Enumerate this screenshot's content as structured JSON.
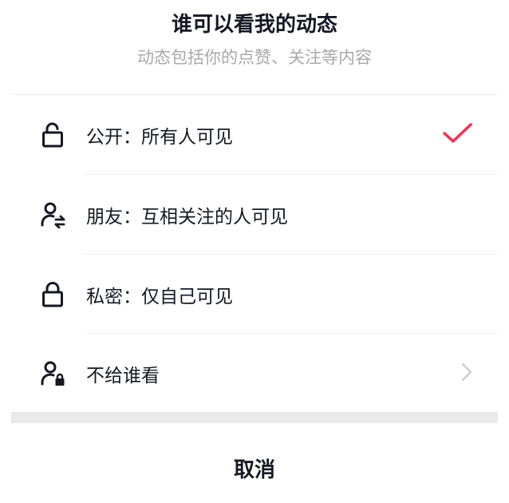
{
  "header": {
    "title": "谁可以看我的动态",
    "subtitle": "动态包括你的点赞、关注等内容"
  },
  "options": [
    {
      "label": "公开：所有人可见",
      "icon": "unlock-icon",
      "selected": true
    },
    {
      "label": "朋友：互相关注的人可见",
      "icon": "friends-icon",
      "selected": false
    },
    {
      "label": "私密：仅自己可见",
      "icon": "lock-icon",
      "selected": false
    },
    {
      "label": "不给谁看",
      "icon": "user-lock-icon",
      "selected": false,
      "has_arrow": true
    }
  ],
  "cancel_label": "取消",
  "colors": {
    "accent": "#fe2c55",
    "text": "#161823",
    "subtext": "#a8a9ad",
    "chevron": "#c4c5c8"
  }
}
